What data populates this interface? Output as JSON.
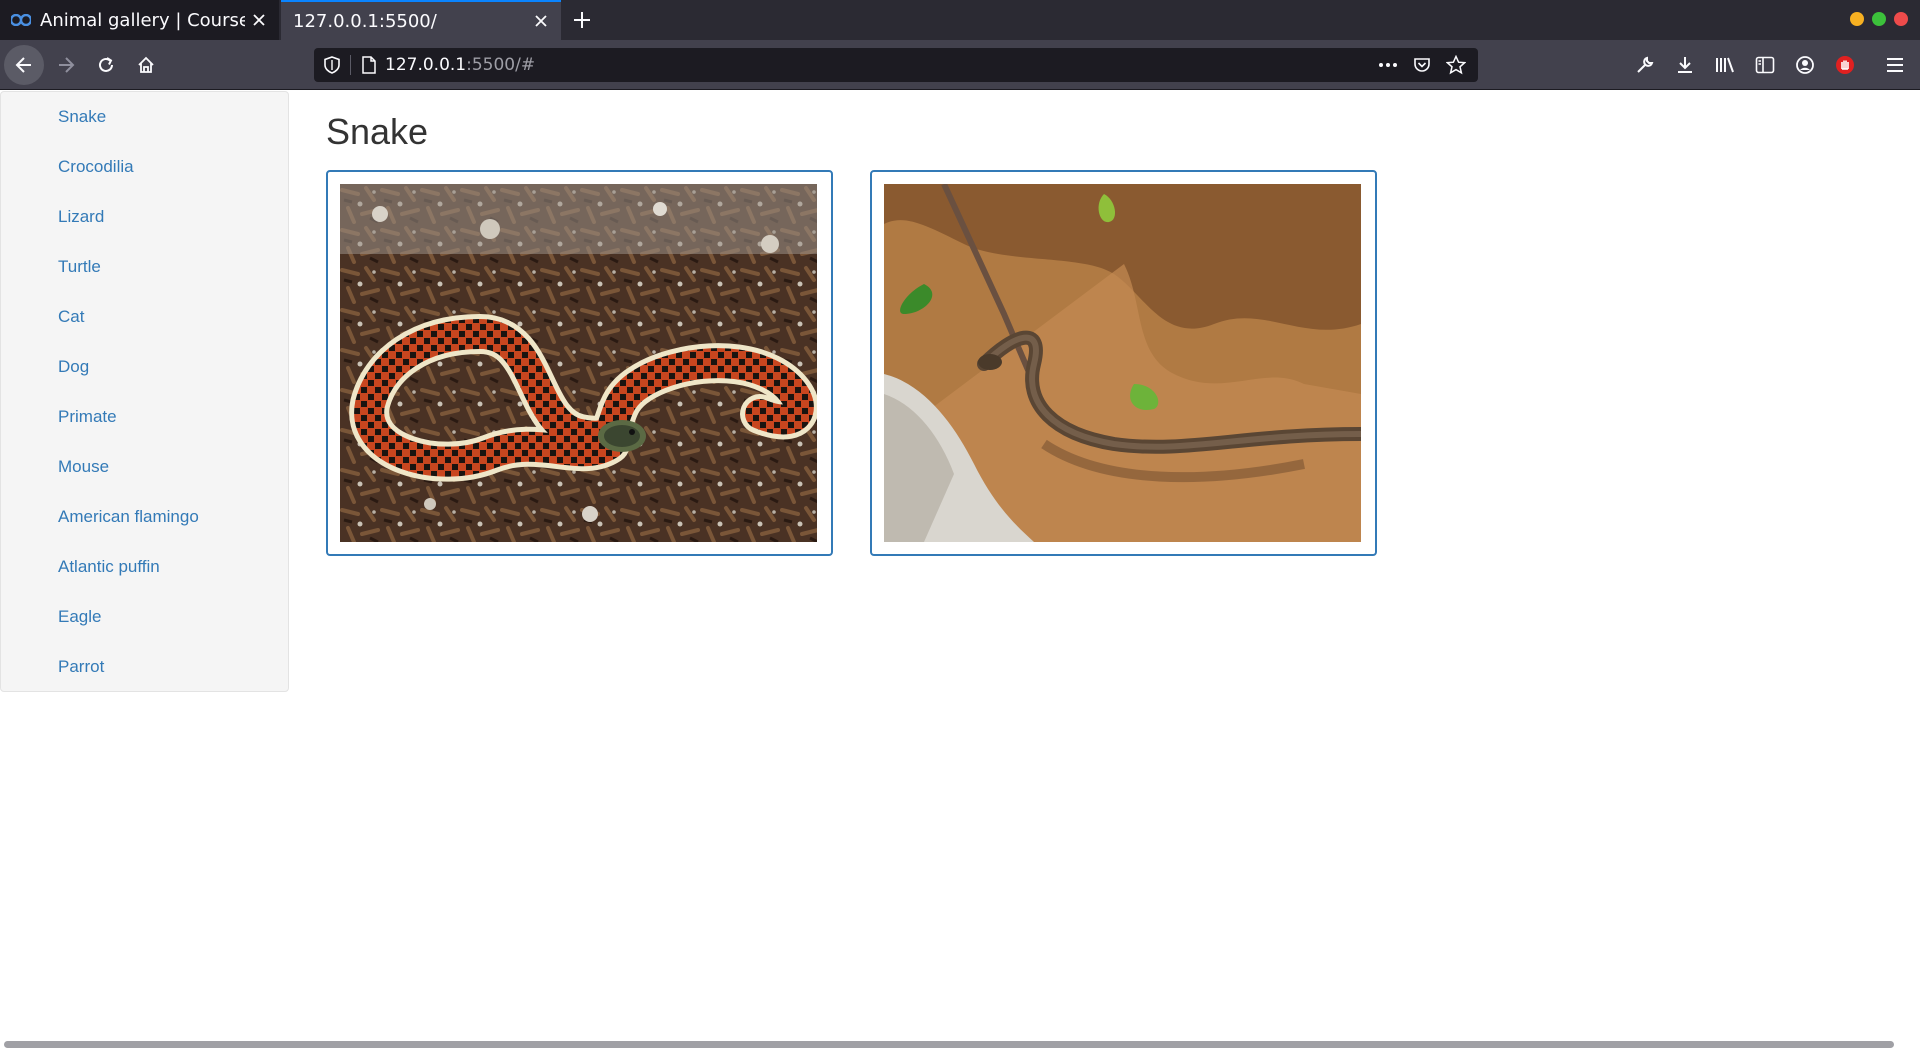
{
  "browser": {
    "tabs": [
      {
        "title": "Animal gallery | Coursera",
        "active": false,
        "favicon": "coursera-icon"
      },
      {
        "title": "127.0.0.1:5500/",
        "active": true,
        "favicon": ""
      }
    ],
    "url": {
      "host": "127.0.0.1",
      "rest": ":5500/#"
    },
    "accent_color": "#0a84ff"
  },
  "sidebar": {
    "items": [
      {
        "label": "Snake"
      },
      {
        "label": "Crocodilia"
      },
      {
        "label": "Lizard"
      },
      {
        "label": "Turtle"
      },
      {
        "label": "Cat"
      },
      {
        "label": "Dog"
      },
      {
        "label": "Primate"
      },
      {
        "label": "Mouse"
      },
      {
        "label": "American flamingo"
      },
      {
        "label": "Atlantic puffin"
      },
      {
        "label": "Eagle"
      },
      {
        "label": "Parrot"
      }
    ],
    "link_color": "#337ab7"
  },
  "main": {
    "title": "Snake",
    "images": [
      {
        "subject": "garter-snake-photo"
      },
      {
        "subject": "water-snake-photo"
      }
    ],
    "thumbnail_border_color": "#337ab7"
  }
}
